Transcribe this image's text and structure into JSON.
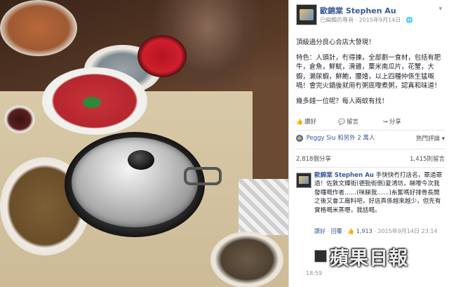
{
  "post": {
    "author": "歐錦棠 Stephen Au",
    "meta": "已編輯的專頁 · 2015年9月14日 · 🌐",
    "caret": "▾",
    "paragraphs": [
      "頂級過分良心合店大發現！",
      "特色：人頭計，冇得揀，全部劃一食材，包括有肥牛，倉魚，鮮魷，滑雞，粟米南瓜片，花蟹，大蝦，瀨尿蝦，鮮鮑，腰燴，以上四種仲係生猛嘅喎！會完火鍋後就用冇粥底嚟煮粥，認真和味道！",
      "幾多錢一位呢？每人兩蚊有找！"
    ],
    "actions": {
      "like": "讚好",
      "comment": "留言",
      "share": "分享"
    },
    "likes_names": "Peggy Siu 和另外 2 萬人",
    "sort_label": "熱門評論 ▾",
    "shares": "2,818個分享",
    "comment_count": "1,415則留言"
  },
  "comment": {
    "author": "歐錦棠 Stephen Au",
    "text": "手快快冇打店名，罪過罪過！佐敦文輝街(德勁街側)夏鴻坊，睇嚟今次我發囉嘅作者……(咪睇我……)糸奮嗎好排骨長開之後又會工廠料吧，好店真係越來越少，但先有實格嘅米蒸嘢，我話嘅。",
    "reply_link": "讚好",
    "reply_action": "回覆",
    "likes": "1,913",
    "time": "2015年9月14日 23:14"
  },
  "reply": {
    "time": "18:59"
  },
  "watermark": "蘋果日報"
}
